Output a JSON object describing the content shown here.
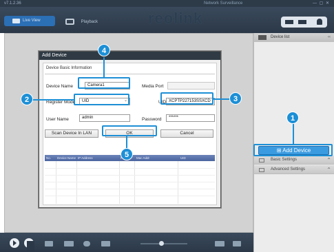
{
  "window": {
    "version": "v7.1.2.36",
    "title": "Network Surveillance",
    "controls": "— ▢ ✕"
  },
  "topbar": {
    "live_tab": "Live View",
    "playback_tab": "Playback",
    "logo": "reolink"
  },
  "right_panel": {
    "device_list_header": "Device list",
    "add_device_label": "Add Device",
    "basic_settings_label": "Basic Settings",
    "advanced_settings_label": "Advanced Settings"
  },
  "dialog": {
    "title": "Add Device",
    "group_title": "Device Basic Information",
    "device_name_label": "Device Name",
    "device_name_value": "Camera1",
    "media_port_label": "Media Port",
    "media_port_value": "",
    "register_mode_label": "Register Mode",
    "register_mode_value": "UID",
    "uid_label": "UID",
    "uid_value": "XCPTP227153SSXCD",
    "user_name_label": "User Name",
    "user_name_value": "admin",
    "password_label": "Password",
    "password_value": "******",
    "scan_button": "Scan Device In LAN",
    "ok_button": "OK",
    "cancel_button": "Cancel",
    "table_headers": [
      "No.",
      "Device Name",
      "IP Address",
      "Port",
      "Mac Addr",
      "UID"
    ]
  },
  "callouts": {
    "one": "1",
    "two": "2",
    "three": "3",
    "four": "4",
    "five": "5"
  },
  "colors": {
    "callout": "#1c8fd6",
    "accent": "#3b9be0",
    "chrome": "#2b3847"
  }
}
